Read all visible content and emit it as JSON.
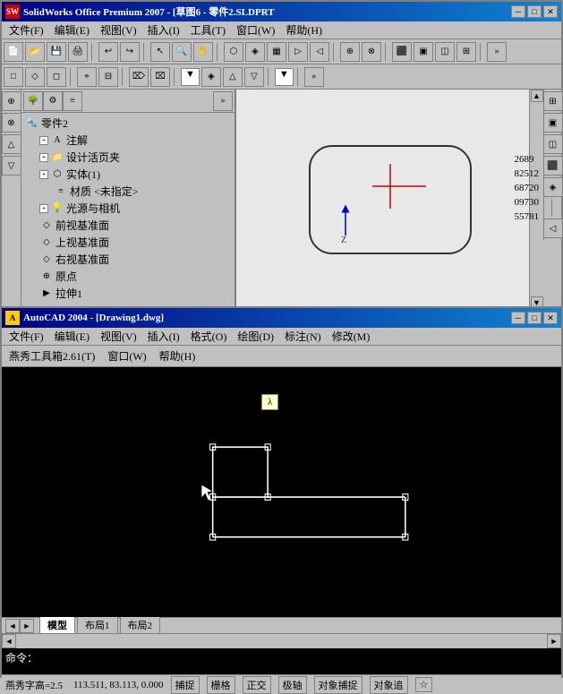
{
  "solidworks": {
    "title": "SolidWorks Office Premium 2007 - [草图6 - 零件2.SLDPRT]",
    "title_short": "SolidWorks Office Premium 2007 - [草图6 - 零件2.SLDPRT",
    "icon_label": "SW",
    "menus": [
      "文件(F)",
      "编辑(E)",
      "视图(V)",
      "插入(I)",
      "工具(T)",
      "窗口(W)",
      "帮助(H)"
    ],
    "tree_items": [
      {
        "label": "零件2",
        "level": 0,
        "icon": "part"
      },
      {
        "label": "注解",
        "level": 1,
        "icon": "note",
        "expand": true
      },
      {
        "label": "设计活页夹",
        "level": 1,
        "icon": "folder",
        "expand": false
      },
      {
        "label": "实体(1)",
        "level": 1,
        "icon": "solid",
        "expand": true
      },
      {
        "label": "材质 <未指定>",
        "level": 2,
        "icon": "material"
      },
      {
        "label": "光源与相机",
        "level": 1,
        "icon": "light",
        "expand": true
      },
      {
        "label": "前视基准面",
        "level": 1,
        "icon": "plane"
      },
      {
        "label": "上视基准面",
        "level": 1,
        "icon": "plane"
      },
      {
        "label": "右视基准面",
        "level": 1,
        "icon": "plane"
      },
      {
        "label": "原点",
        "level": 1,
        "icon": "origin"
      },
      {
        "label": "拉伸1",
        "level": 1,
        "icon": "extrude"
      }
    ],
    "numbers": [
      "2689",
      "82512",
      "68720",
      "09730",
      "55781"
    ]
  },
  "autocad": {
    "title": "AutoCAD 2004 - [Drawing1.dwg]",
    "icon_label": "A",
    "menus": [
      "文件(F)",
      "编辑(E)",
      "视图(V)",
      "插入(I)",
      "格式(O)",
      "绘图(D)",
      "标注(N)",
      "修改(M)"
    ],
    "toolbar_label": "燕秀工具箱2.61(T)",
    "window_menu": "窗口(W)",
    "help_menu": "帮助(H)",
    "tooltip_text": "λ",
    "tabs": [
      {
        "label": "模型",
        "active": true
      },
      {
        "label": "布局1",
        "active": false
      },
      {
        "label": "布局2",
        "active": false
      }
    ],
    "command_label": "命令：",
    "statusbar": {
      "coords": "113.511, 83.113, 0.000",
      "snap": "捕捉",
      "grid": "栅格",
      "ortho": "正交",
      "polar": "极轴",
      "osnap": "对象捕捉",
      "otrack": "对象追",
      "extra": "☆"
    },
    "font_label": "燕秀字高=2.5"
  },
  "icons": {
    "minimize": "─",
    "maximize": "□",
    "close": "✕",
    "expand": "+",
    "collapse": "─",
    "arrow_left": "◄",
    "arrow_right": "►",
    "arrow_up": "▲",
    "arrow_down": "▼"
  }
}
